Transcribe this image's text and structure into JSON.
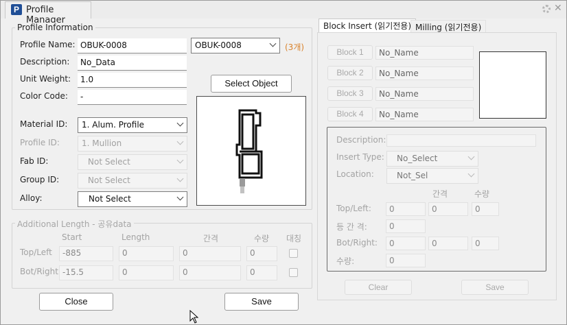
{
  "window": {
    "title": "Profile Manager",
    "logo": "P",
    "icons": [
      "gear-icon",
      "close-icon"
    ]
  },
  "profile_info": {
    "legend": "Profile Information",
    "profile_name_label": "Profile Name:",
    "profile_name_value": "OBUK-0008",
    "profile_select_value": "OBUK-0008",
    "count_text": "(3개)",
    "description_label": "Description:",
    "description_value": "No_Data",
    "unit_weight_label": "Unit Weight:",
    "unit_weight_value": "1.0",
    "color_code_label": "Color Code:",
    "color_code_value": "-",
    "material_id_label": "Material ID:",
    "material_id_value": "1. Alum. Profile",
    "profile_id_label": "Profile ID:",
    "profile_id_value": "1. Mullion",
    "fab_id_label": "Fab ID:",
    "fab_id_value": "Not Select",
    "group_id_label": "Group ID:",
    "group_id_value": "Not Select",
    "alloy_label": "Alloy:",
    "alloy_value": "Not Select",
    "select_object_label": "Select Object"
  },
  "additional_length": {
    "legend": "Additional Length - 공유data",
    "headers": {
      "start": "Start",
      "length": "Length",
      "gap": "간격",
      "qty": "수량",
      "mirror": "대칭"
    },
    "rows": [
      {
        "label": "Top/Left",
        "start": "-885",
        "length": "0",
        "gap": "0",
        "qty": "0",
        "mirror": false
      },
      {
        "label": "Bot/Right",
        "start": "-15.5",
        "length": "0",
        "gap": "0",
        "qty": "0",
        "mirror": false
      }
    ]
  },
  "footer": {
    "close_label": "Close",
    "save_label": "Save"
  },
  "tabs": {
    "block_insert": "Block Insert (읽기전용)",
    "milling": "Milling (읽기전용)"
  },
  "block_insert": {
    "blocks": [
      {
        "button": "Block 1",
        "value": "No_Name"
      },
      {
        "button": "Block 2",
        "value": "No_Name"
      },
      {
        "button": "Block 3",
        "value": "No_Name"
      },
      {
        "button": "Block 4",
        "value": "No_Name"
      }
    ],
    "description_label": "Description:",
    "description_value": "",
    "insert_type_label": "Insert Type:",
    "insert_type_value": "No_Select",
    "location_label": "Location:",
    "location_value": "Not_Sel",
    "col_gap": "간격",
    "col_qty": "수량",
    "top_left_label": "Top/Left:",
    "top_left": [
      "0",
      "0",
      "0"
    ],
    "equal_gap_label": "등 간 격:",
    "equal_gap_value": "0",
    "bot_right_label": "Bot/Right:",
    "bot_right": [
      "0",
      "0",
      "0"
    ],
    "qty_label": "수량:",
    "qty_value": "0",
    "clear_label": "Clear",
    "save_label": "Save"
  }
}
